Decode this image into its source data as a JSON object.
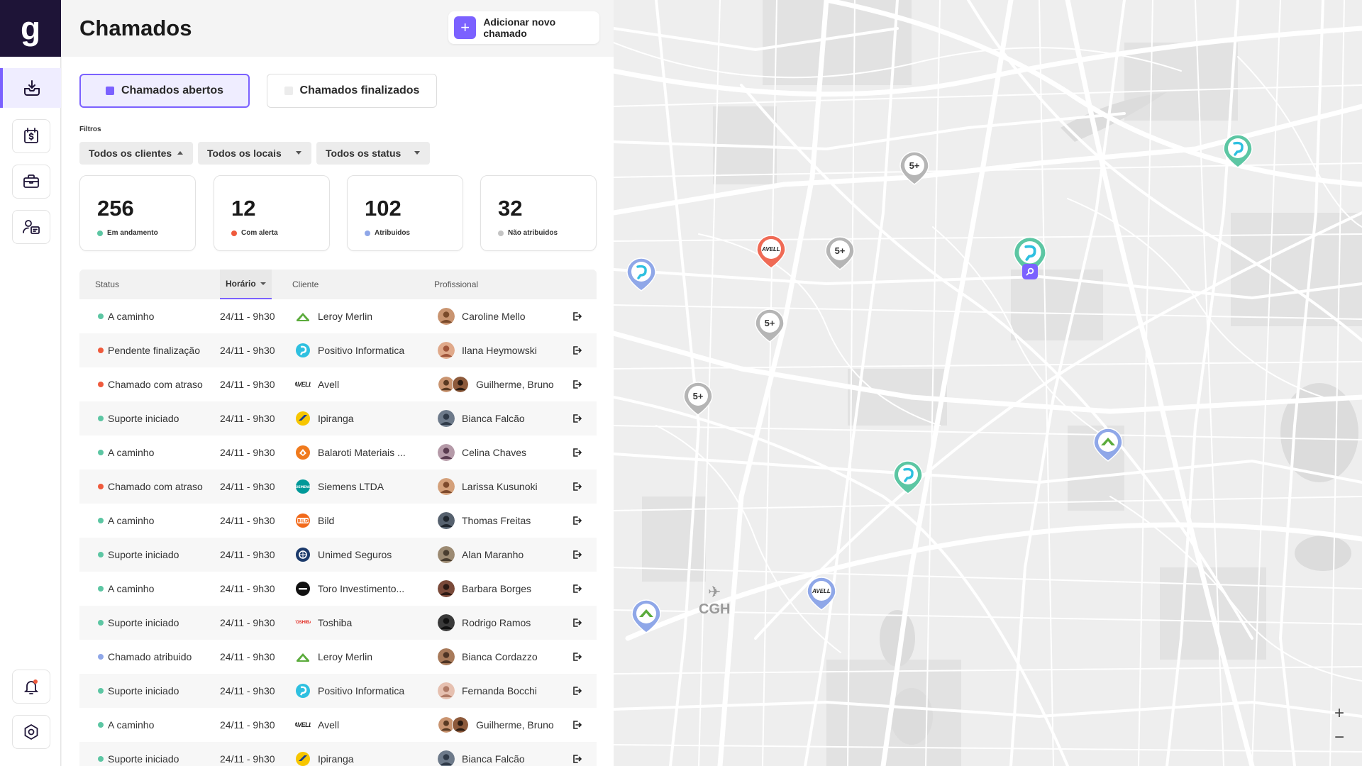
{
  "app": {
    "logo_letter": "g"
  },
  "header": {
    "title": "Chamados",
    "add_button": "Adicionar novo chamado",
    "add_icon": "+"
  },
  "tabs": {
    "open": "Chamados abertos",
    "closed": "Chamados finalizados"
  },
  "filters": {
    "label": "Filtros",
    "clients": "Todos os clientes",
    "locations": "Todos os locais",
    "statuses": "Todos os status"
  },
  "stats": [
    {
      "value": "256",
      "label": "Em andamento",
      "color": "#5cc6a3"
    },
    {
      "value": "12",
      "label": "Com alerta",
      "color": "#ef5a3c"
    },
    {
      "value": "102",
      "label": "Atribuidos",
      "color": "#8fa7e8"
    },
    {
      "value": "32",
      "label": "Não atribuidos",
      "color": "#c4c4c4"
    }
  ],
  "table": {
    "headers": {
      "status": "Status",
      "time": "Horário",
      "client": "Cliente",
      "professional": "Profissional"
    },
    "rows": [
      {
        "status": "A caminho",
        "time": "24/11 - 9h30",
        "client": "Leroy Merlin",
        "professional": "Caroline Mello"
      },
      {
        "status": "Pendente finalização",
        "time": "24/11 - 9h30",
        "client": "Positivo Informatica",
        "professional": "Ilana Heymowski"
      },
      {
        "status": "Chamado com atraso",
        "time": "24/11 - 9h30",
        "client": "Avell",
        "professional": "Guilherme, Bruno"
      },
      {
        "status": "Suporte iniciado",
        "time": "24/11 - 9h30",
        "client": "Ipiranga",
        "professional": "Bianca Falcão"
      },
      {
        "status": "A caminho",
        "time": "24/11 - 9h30",
        "client": "Balaroti Materiais ...",
        "professional": "Celina Chaves"
      },
      {
        "status": "Chamado com atraso",
        "time": "24/11 - 9h30",
        "client": "Siemens LTDA",
        "professional": "Larissa Kusunoki"
      },
      {
        "status": "A caminho",
        "time": "24/11 - 9h30",
        "client": "Bild",
        "professional": "Thomas Freitas"
      },
      {
        "status": "Suporte iniciado",
        "time": "24/11 - 9h30",
        "client": "Unimed Seguros",
        "professional": "Alan Maranho"
      },
      {
        "status": "A caminho",
        "time": "24/11 - 9h30",
        "client": "Toro Investimento...",
        "professional": "Barbara Borges"
      },
      {
        "status": "Suporte iniciado",
        "time": "24/11 - 9h30",
        "client": "Toshiba",
        "professional": "Rodrigo Ramos"
      },
      {
        "status": "Chamado atribuido",
        "time": "24/11 - 9h30",
        "client": "Leroy Merlin",
        "professional": "Bianca Cordazzo"
      },
      {
        "status": "Suporte iniciado",
        "time": "24/11 - 9h30",
        "client": "Positivo Informatica",
        "professional": "Fernanda Bocchi"
      },
      {
        "status": "A caminho",
        "time": "24/11 - 9h30",
        "client": "Avell",
        "professional": "Guilherme, Bruno"
      },
      {
        "status": "Suporte iniciado",
        "time": "24/11 - 9h30",
        "client": "Ipiranga",
        "professional": "Bianca Falcão"
      }
    ]
  },
  "map": {
    "cluster_label": "5+",
    "airport_label": "CGH",
    "zoom_in": "+",
    "zoom_out": "−",
    "client_label_avell": "AVELL"
  },
  "colors": {
    "accent": "#7b61ff",
    "green": "#5cc6a3",
    "red": "#ef5a3c",
    "blue": "#8fa7e8",
    "gray": "#c4c4c4",
    "sidebar_dark": "#1e1437"
  }
}
